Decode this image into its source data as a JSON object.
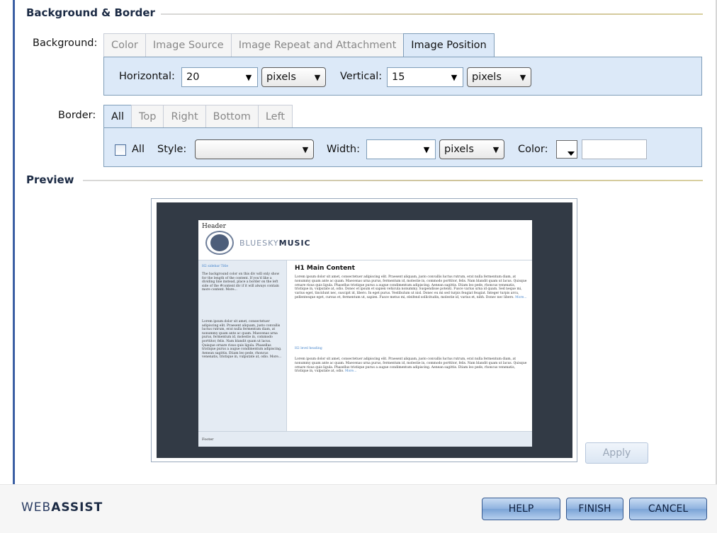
{
  "sections": {
    "background_border": "Background & Border",
    "preview": "Preview"
  },
  "background": {
    "label": "Background:",
    "tabs": [
      "Color",
      "Image Source",
      "Image Repeat and Attachment",
      "Image Position"
    ],
    "active_tab": "Image Position",
    "horizontal_label": "Horizontal:",
    "horizontal_value": "20",
    "horizontal_unit": "pixels",
    "vertical_label": "Vertical:",
    "vertical_value": "15",
    "vertical_unit": "pixels"
  },
  "border": {
    "label": "Border:",
    "tabs": [
      "All",
      "Top",
      "Right",
      "Bottom",
      "Left"
    ],
    "active_tab": "All",
    "all_checkbox_label": "All",
    "all_checked": false,
    "style_label": "Style:",
    "style_value": "",
    "width_label": "Width:",
    "width_value": "",
    "width_unit": "pixels",
    "color_label": "Color:",
    "color_value": ""
  },
  "preview": {
    "header_text": "Header",
    "logo_text_light": "BLUESKY",
    "logo_text_bold": "MUSIC",
    "sidebar_title": "H2 sidebar Title",
    "sidebar_para1": "The background color on this div will only show for the length of the content. If you'd like a dividing line instead, place a border on the left side of the #content div if it will always contain more content. More...",
    "sidebar_para2": "Lorem ipsum dolor sit amet, consectetuer adipiscing elit. Praesent aliquam, justo convallis luctus rutrum, erat nulla fermentum diam, at nonummy quam ante ac quam. Maecenas urna purus, fermentum id, molestie in, commodo porttitor, felis. Nam blandit quam ut lacus. Quisque ornare risus quis ligula. Phasellus tristique purus a augue condimentum adipiscing. Aenean sagittis. Etiam leo pede, rhoncus venenatis, tristique in, vulputate at, odio. More...",
    "main_title": "H1 Main Content",
    "main_para1": "Lorem ipsum dolor sit amet, consectetuer adipiscing elit. Praesent aliquam, justo convallis luctus rutrum, erat nulla fermentum diam, at nonummy quam ante ac quam. Maecenas urna purus, fermentum id, molestie in, commodo porttitor, felis. Nam blandit quam ut lacus. Quisque ornare risus quis ligula. Phasellus tristique purus a augue condimentum adipiscing. Aenean sagittis. Etiam leo pede, rhoncus venenatis, tristique in, vulputate at, odio. Donec et ipsum et sapien vehicula nonummy. Suspendisse potenti. Fusce varius urna id quam. Sed neque mi, varius eget, tincidunt nec, suscipit id, libero. In eget purus. Vestibulum ut nisl. Donec eu mi sed turpis feugiat feugiat. Integer turpis arcu, pellentesque eget, cursus et, fermentum ut, sapien. Fusce metus mi, eleifend sollicitudin, molestie id, varius et, nibh. Donec nec libero.",
    "main_para1_more": "More...",
    "main_h2": "H2 level heading",
    "main_para2": "Lorem ipsum dolor sit amet, consectetuer adipiscing elit. Praesent aliquam, justo convallis luctus rutrum, erat nulla fermentum diam, at nonummy quam ante ac quam. Maecenas urna purus, fermentum id, molestie in, commodo porttitor, felis. Nam blandit quam ut lacus. Quisque ornare risus quis ligula. Phasellus tristique purus a augue condimentum adipiscing. Aenean sagittis. Etiam leo pede, rhoncus venenatis, tristique in, vulputate at, odio.",
    "main_para2_more": "More...",
    "footer_text": "Footer"
  },
  "buttons": {
    "apply": "Apply",
    "help": "HELP",
    "finish": "FINISH",
    "cancel": "CANCEL"
  },
  "brand": {
    "light": "WEB",
    "bold": "ASSIST"
  },
  "colors": {
    "accent_blue": "#3b5fa3",
    "tab_panel": "#dce9f8",
    "preview_bg": "#323a45"
  }
}
